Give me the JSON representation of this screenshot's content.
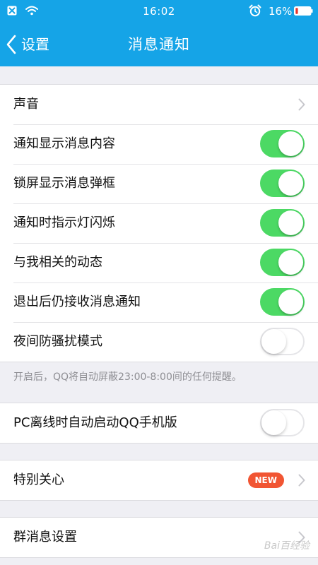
{
  "status_bar": {
    "time": "16:02",
    "battery_percent": "16%",
    "battery_level": 0.16,
    "icons": [
      "notification-icon",
      "wifi-icon",
      "alarm-icon",
      "battery-icon"
    ]
  },
  "nav": {
    "back_label": "设置",
    "title": "消息通知",
    "background": "#15a4e7"
  },
  "group1": [
    {
      "label": "声音",
      "type": "chevron"
    },
    {
      "label": "通知显示消息内容",
      "type": "toggle",
      "on": true
    },
    {
      "label": "锁屏显示消息弹框",
      "type": "toggle",
      "on": true
    },
    {
      "label": "通知时指示灯闪烁",
      "type": "toggle",
      "on": true
    },
    {
      "label": "与我相关的动态",
      "type": "toggle",
      "on": true
    },
    {
      "label": "退出后仍接收消息通知",
      "type": "toggle",
      "on": true
    },
    {
      "label": "夜间防骚扰模式",
      "type": "toggle",
      "on": false
    }
  ],
  "night_mode_hint": "开启后，QQ将自动屏蔽23:00-8:00间的任何提醒。",
  "group2": [
    {
      "label": "PC离线时自动启动QQ手机版",
      "type": "toggle",
      "on": false
    }
  ],
  "group3": [
    {
      "label": "特别关心",
      "type": "chevron",
      "badge": "NEW"
    }
  ],
  "group4": [
    {
      "label": "群消息设置",
      "type": "chevron"
    }
  ],
  "watermark": "Bai百经验",
  "colors": {
    "toggle_on": "#4cd964",
    "badge": "#f15533",
    "page_bg": "#efeff4"
  }
}
